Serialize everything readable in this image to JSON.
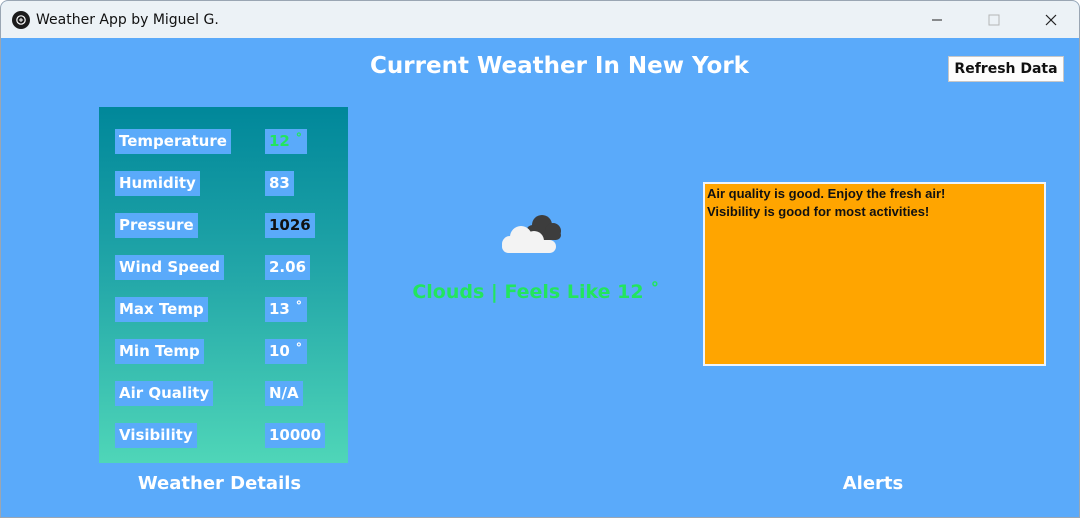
{
  "window": {
    "title": "Weather App by Miguel G."
  },
  "header": {
    "title": "Current Weather In New York",
    "refresh_label": "Refresh Data"
  },
  "details": {
    "section_title": "Weather Details",
    "rows": [
      {
        "label": "Temperature",
        "value": "12 ˚",
        "value_color": "#22e55e"
      },
      {
        "label": "Humidity",
        "value": "83",
        "value_color": "#ffffff"
      },
      {
        "label": "Pressure",
        "value": "1026",
        "value_color": "#111111"
      },
      {
        "label": "Wind Speed",
        "value": "2.06",
        "value_color": "#ffffff"
      },
      {
        "label": "Max Temp",
        "value": "13 ˚",
        "value_color": "#ffffff"
      },
      {
        "label": "Min Temp",
        "value": "10 ˚",
        "value_color": "#ffffff"
      },
      {
        "label": "Air Quality",
        "value": "N/A",
        "value_color": "#ffffff"
      },
      {
        "label": "Visibility",
        "value": "10000",
        "value_color": "#ffffff"
      }
    ]
  },
  "current": {
    "icon": "cloud-icon",
    "condition": "Clouds | Feels Like 12 ˚"
  },
  "alerts": {
    "section_title": "Alerts",
    "lines": [
      "Air quality is good. Enjoy the fresh air!",
      "Visibility is good for most activities!"
    ]
  },
  "colors": {
    "background": "#5aaafa",
    "panel_gradient_top": "#00879a",
    "panel_gradient_bottom": "#4fd6b8",
    "alert_box": "#ffa500",
    "accent_green": "#22e55e"
  }
}
